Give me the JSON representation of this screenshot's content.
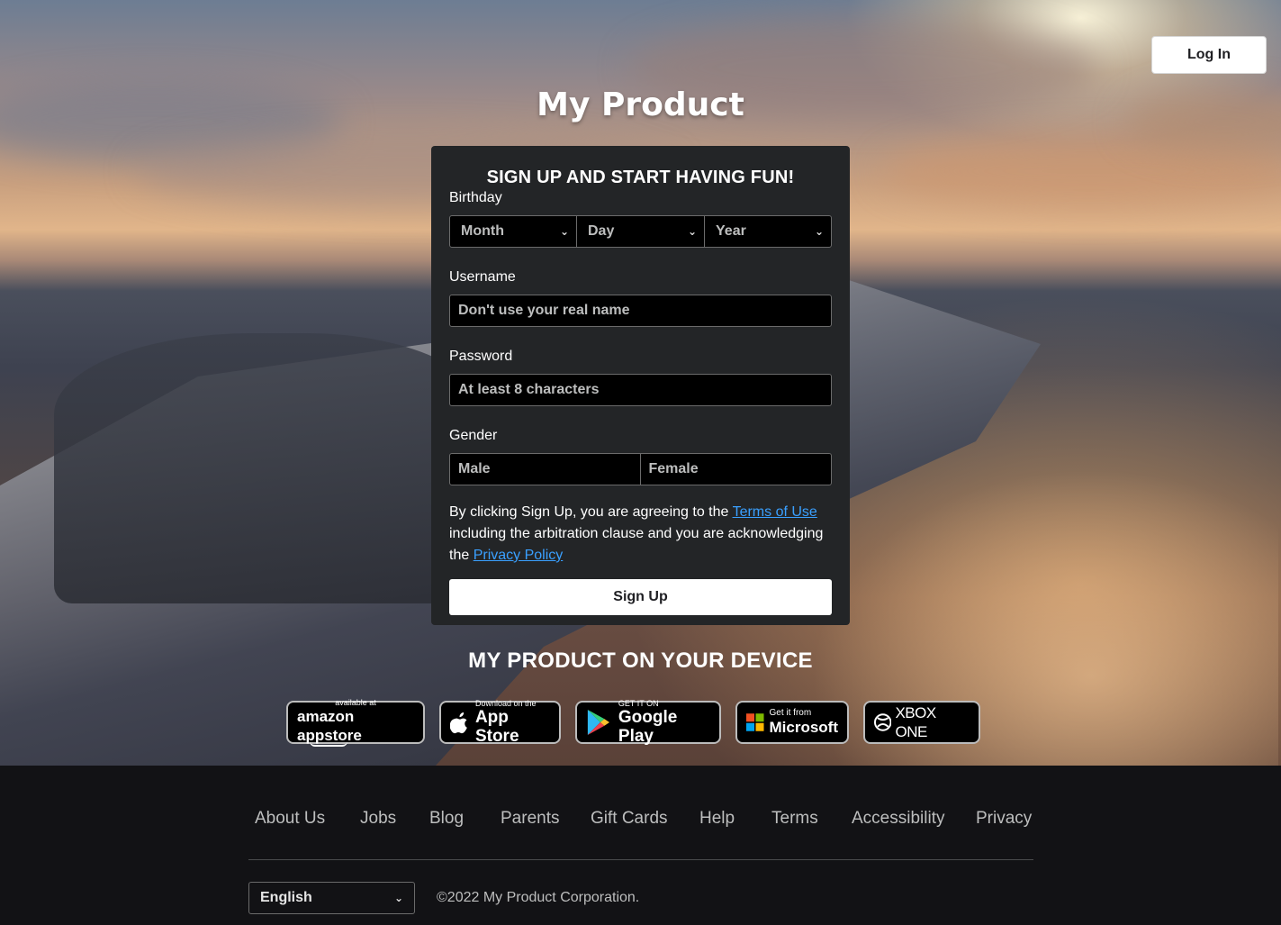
{
  "header": {
    "login_label": "Log In"
  },
  "brand": {
    "title": "My Product"
  },
  "signup": {
    "title": "SIGN UP AND START HAVING FUN!",
    "birthday_label": "Birthday",
    "month": "Month",
    "day": "Day",
    "year": "Year",
    "username_label": "Username",
    "username_placeholder": "Don't use your real name",
    "password_label": "Password",
    "password_placeholder": "At least 8 characters",
    "gender_label": "Gender",
    "gender_male": "Male",
    "gender_female": "Female",
    "legal_1": "By clicking Sign Up, you are agreeing to the ",
    "terms_link": "Terms of Use",
    "legal_2": " including the arbitration clause and you are acknowledging the ",
    "privacy_link": "Privacy Policy",
    "button": "Sign Up"
  },
  "devices": {
    "title": "MY PRODUCT ON YOUR DEVICE",
    "stores": [
      {
        "small": "available at",
        "big": "amazon appstore",
        "icon": "amazon-icon"
      },
      {
        "small": "Download on the",
        "big": "App Store",
        "icon": "apple-icon"
      },
      {
        "small": "GET IT ON",
        "big": "Google Play",
        "icon": "google-play-icon"
      },
      {
        "small": "Get it from",
        "big": "Microsoft",
        "icon": "microsoft-icon"
      },
      {
        "small": "",
        "big": "XBOX ONE",
        "icon": "xbox-icon"
      }
    ]
  },
  "footer": {
    "links": [
      "About Us",
      "Jobs",
      "Blog",
      "Parents",
      "Gift Cards",
      "Help",
      "Terms",
      "Accessibility",
      "Privacy"
    ],
    "language": "English",
    "copyright": "©2022 My Product Corporation."
  }
}
